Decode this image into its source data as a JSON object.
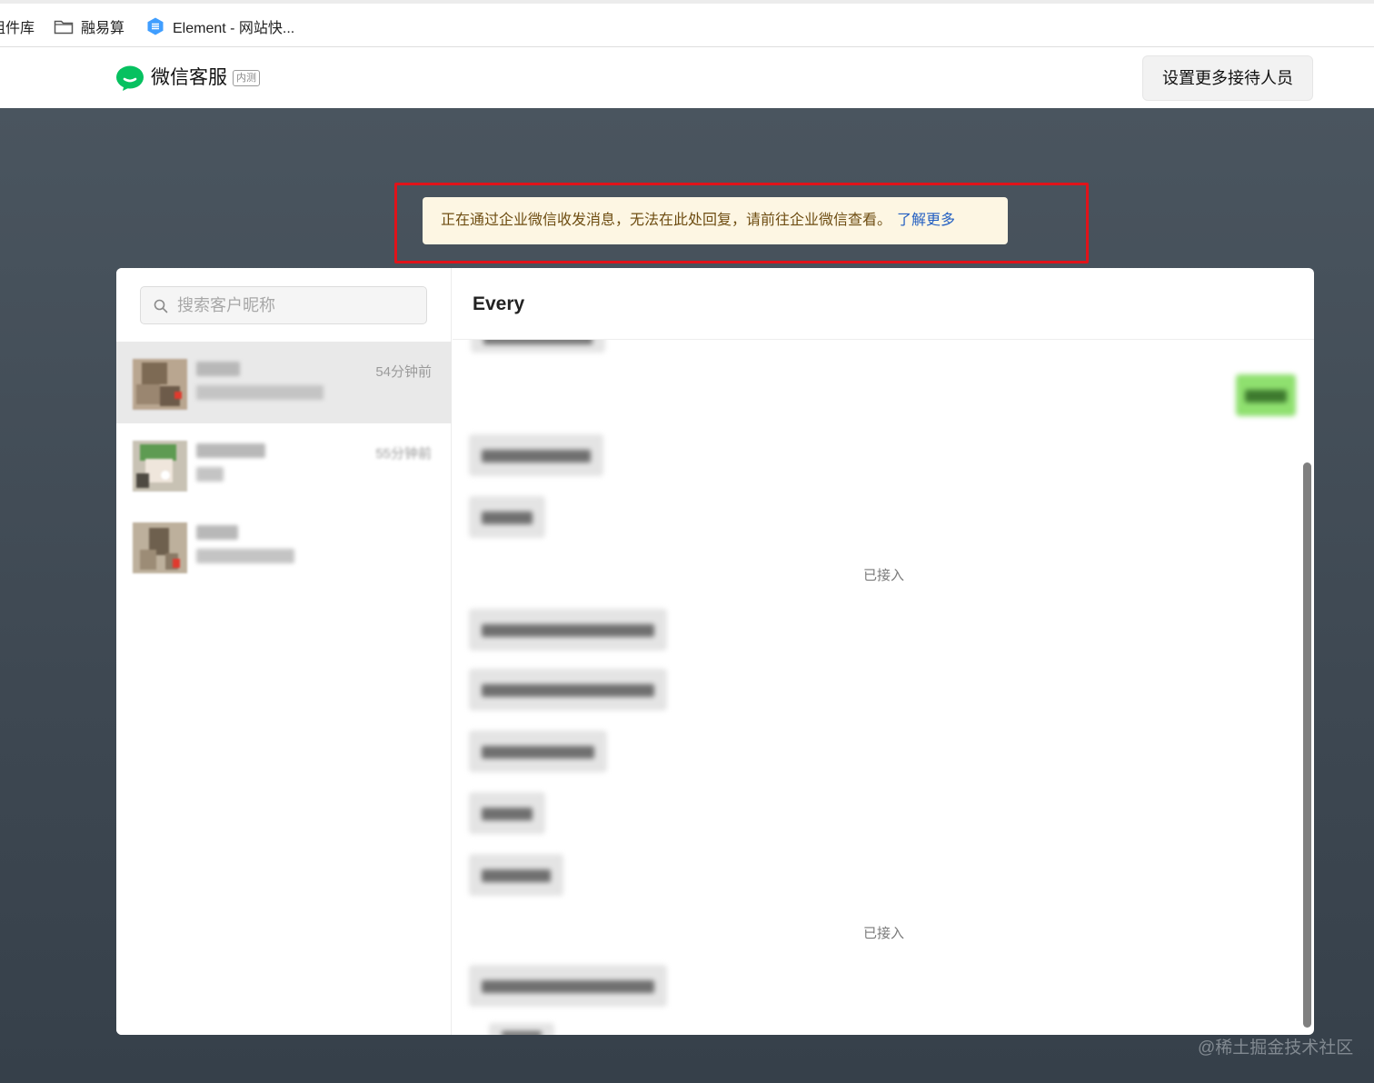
{
  "bookmarks": [
    {
      "label": "组件库",
      "icon": "none"
    },
    {
      "label": "融易算",
      "icon": "folder-icon"
    },
    {
      "label": "Element - 网站快...",
      "icon": "element-logo-icon"
    }
  ],
  "app": {
    "title": "微信客服",
    "badge": "内测",
    "settings_button": "设置更多接待人员",
    "brand_color": "#07c160"
  },
  "notice": {
    "text": "正在通过企业微信收发消息，无法在此处回复，请前往企业微信查看。",
    "link": "了解更多"
  },
  "search": {
    "placeholder": "搜索客户昵称"
  },
  "contacts": [
    {
      "time": "54分钟前",
      "active": true
    },
    {
      "time": "55分钟前",
      "active": false
    },
    {
      "time": "",
      "active": false
    }
  ],
  "chat": {
    "title": "Every",
    "system_messages": [
      "已接入",
      "已接入"
    ]
  },
  "watermark": "@稀土掘金技术社区"
}
